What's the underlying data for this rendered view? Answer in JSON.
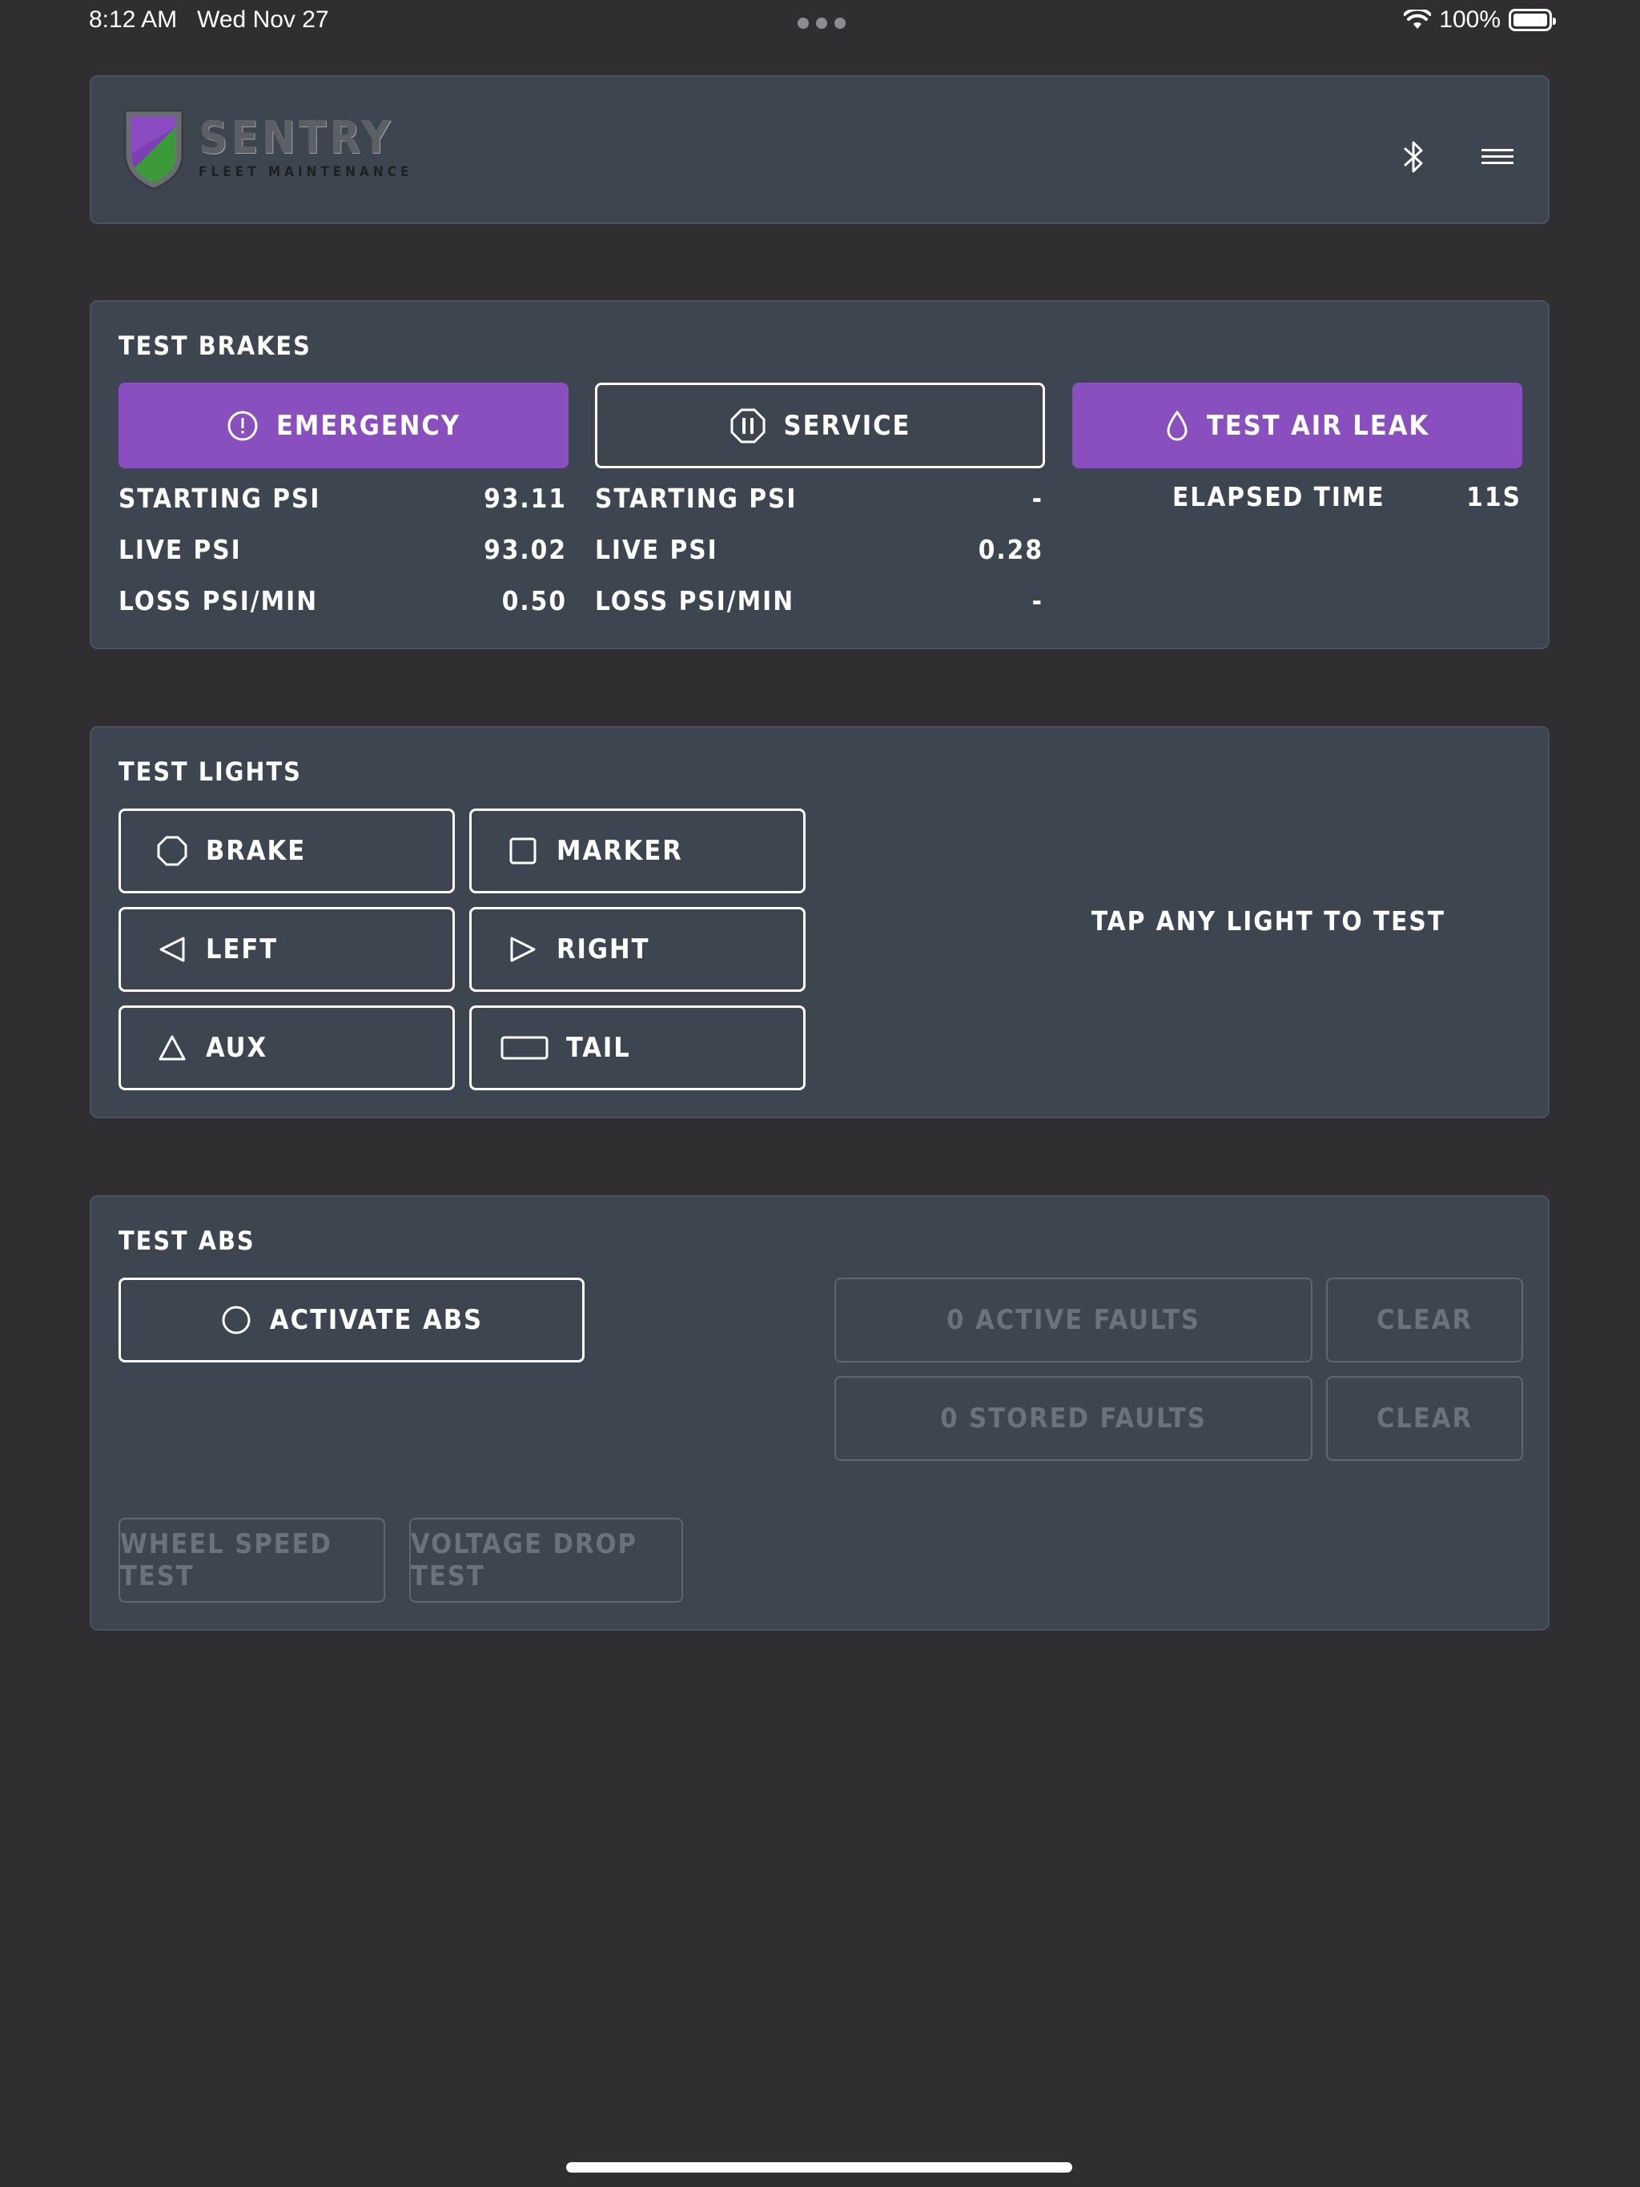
{
  "status_bar": {
    "time": "8:12 AM",
    "date": "Wed Nov 27",
    "battery": "100%"
  },
  "header": {
    "logo_brand": "SENTRY",
    "logo_sub": "FLEET MAINTENANCE",
    "icons": [
      "bluetooth-icon",
      "menu-icon"
    ]
  },
  "brakes": {
    "title": "TEST BRAKES",
    "emergency_label": "EMERGENCY",
    "service_label": "SERVICE",
    "air_leak_label": "TEST AIR LEAK",
    "emergency_stats": [
      {
        "label": "STARTING PSI",
        "value": "93.11"
      },
      {
        "label": "LIVE PSI",
        "value": "93.02"
      },
      {
        "label": "LOSS PSI/MIN",
        "value": "0.50"
      }
    ],
    "service_stats": [
      {
        "label": "STARTING PSI",
        "value": "-"
      },
      {
        "label": "LIVE PSI",
        "value": "0.28"
      },
      {
        "label": "LOSS PSI/MIN",
        "value": "-"
      }
    ],
    "elapsed_label": "ELAPSED TIME",
    "elapsed_value": "11S"
  },
  "lights": {
    "title": "TEST LIGHTS",
    "buttons": [
      {
        "label": "BRAKE",
        "icon": "octagon-icon"
      },
      {
        "label": "MARKER",
        "icon": "square-icon"
      },
      {
        "label": "LEFT",
        "icon": "triangle-left-icon"
      },
      {
        "label": "RIGHT",
        "icon": "triangle-right-icon"
      },
      {
        "label": "AUX",
        "icon": "triangle-up-icon"
      },
      {
        "label": "TAIL",
        "icon": "rectangle-icon"
      }
    ],
    "hint": "TAP ANY LIGHT TO TEST"
  },
  "abs": {
    "title": "TEST ABS",
    "activate_label": "ACTIVATE ABS",
    "active_faults_label": "0 ACTIVE FAULTS",
    "stored_faults_label": "0 STORED FAULTS",
    "clear_label": "CLEAR",
    "wheel_speed_label": "WHEEL SPEED TEST",
    "voltage_drop_label": "VOLTAGE DROP TEST"
  },
  "colors": {
    "background": "#302e30",
    "card": "#3d4650",
    "accent_purple": "#8a4fbe",
    "disabled_text": "#6a737d"
  }
}
